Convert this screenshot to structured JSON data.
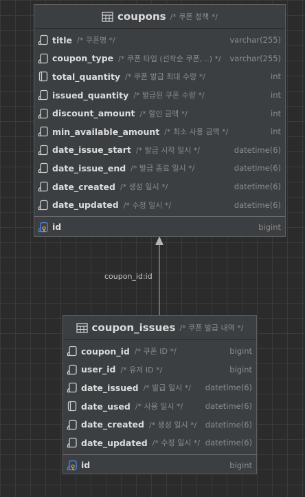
{
  "relation": {
    "label": "coupon_id:id"
  },
  "tables": {
    "coupons": {
      "name": "coupons",
      "comment": "/* 쿠폰 정책 */",
      "columns": [
        {
          "name": "title",
          "comment": "/* 쿠폰명 */",
          "type": "varchar(255)",
          "icon": "column-icon"
        },
        {
          "name": "coupon_type",
          "comment": "/* 쿠폰 타입 (선착순 쿠폰, ..) */",
          "type": "varchar(255)",
          "icon": "column-icon"
        },
        {
          "name": "total_quantity",
          "comment": "/* 쿠폰 발급 최대 수량 */",
          "type": "int",
          "icon": "nullable-column-icon"
        },
        {
          "name": "issued_quantity",
          "comment": "/* 발급된 쿠폰 수량 */",
          "type": "int",
          "icon": "column-icon"
        },
        {
          "name": "discount_amount",
          "comment": "/* 할인 금액 */",
          "type": "int",
          "icon": "column-icon"
        },
        {
          "name": "min_available_amount",
          "comment": "/* 최소 사용 금액 */",
          "type": "int",
          "icon": "column-icon"
        },
        {
          "name": "date_issue_start",
          "comment": "/* 발급 시작 일시 */",
          "type": "datetime(6)",
          "icon": "column-icon"
        },
        {
          "name": "date_issue_end",
          "comment": "/* 발급 종료 일시 */",
          "type": "datetime(6)",
          "icon": "column-icon"
        },
        {
          "name": "date_created",
          "comment": "/* 생성 일시 */",
          "type": "datetime(6)",
          "icon": "column-icon"
        },
        {
          "name": "date_updated",
          "comment": "/* 수정 일시 */",
          "type": "datetime(6)",
          "icon": "column-icon"
        }
      ],
      "pk": {
        "name": "id",
        "comment": "",
        "type": "bigint",
        "icon": "primary-key-icon"
      }
    },
    "coupon_issues": {
      "name": "coupon_issues",
      "comment": "/* 쿠폰 발급 내역 */",
      "columns": [
        {
          "name": "coupon_id",
          "comment": "/* 쿠폰 ID */",
          "type": "bigint",
          "icon": "column-icon"
        },
        {
          "name": "user_id",
          "comment": "/* 유저 ID */",
          "type": "bigint",
          "icon": "column-icon"
        },
        {
          "name": "date_issued",
          "comment": "/* 발급 일시 */",
          "type": "datetime(6)",
          "icon": "column-icon"
        },
        {
          "name": "date_used",
          "comment": "/* 사용 일시 */",
          "type": "datetime(6)",
          "icon": "nullable-column-icon"
        },
        {
          "name": "date_created",
          "comment": "/* 생성 일시 */",
          "type": "datetime(6)",
          "icon": "column-icon"
        },
        {
          "name": "date_updated",
          "comment": "/* 수정 일시 */",
          "type": "datetime(6)",
          "icon": "column-icon"
        }
      ],
      "pk": {
        "name": "id",
        "comment": "",
        "type": "bigint",
        "icon": "primary-key-icon"
      }
    }
  },
  "colors": {
    "text": "#dcdcdc",
    "muted": "#8c8c8c",
    "key_blue": "#4a86e8",
    "key_gold": "#d4a94a"
  }
}
